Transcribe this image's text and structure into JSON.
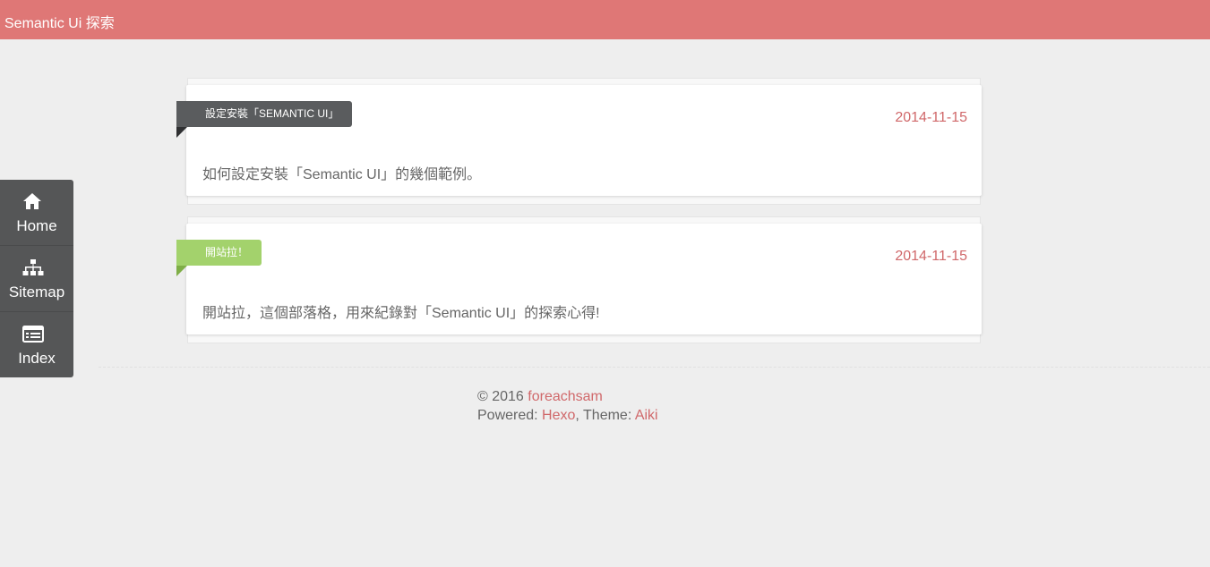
{
  "header": {
    "title": "Semantic Ui 探索",
    "color": "#df7776"
  },
  "sidenav": {
    "items": [
      {
        "label": "Home",
        "icon": "home-icon"
      },
      {
        "label": "Sitemap",
        "icon": "sitemap-icon"
      },
      {
        "label": "Index",
        "icon": "list-icon"
      }
    ]
  },
  "posts": [
    {
      "title": "設定安裝「SEMANTIC UI」",
      "date": "2014-11-15",
      "excerpt": "如何設定安裝「Semantic UI」的幾個範例。",
      "ribbon_color": "#5a5c5e"
    },
    {
      "title": "開站拉！",
      "date": "2014-11-15",
      "excerpt": "開站拉，這個部落格，用來紀錄對「Semantic UI」的探索心得!",
      "ribbon_color": "#a3d26c"
    }
  ],
  "footer": {
    "copyright": "© 2016",
    "author": "foreachsam",
    "powered_label": "Powered:",
    "powered_link": "Hexo",
    "theme_label": "Theme:",
    "theme_link": "Aiki"
  },
  "colors": {
    "accent": "#d0686a",
    "background": "#eeeeee",
    "nav": "#555657"
  }
}
